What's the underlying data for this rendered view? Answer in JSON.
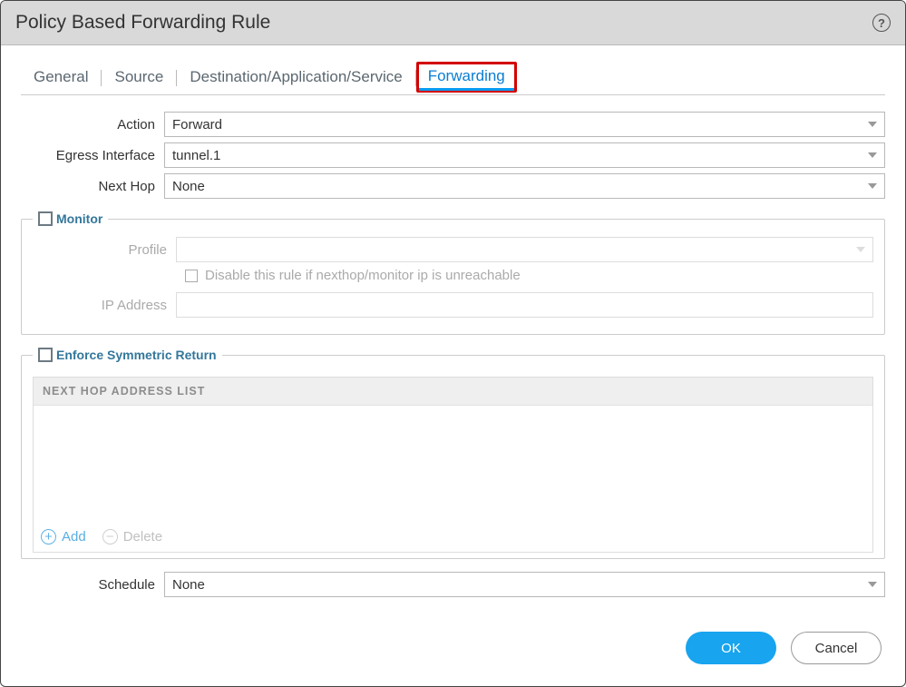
{
  "title": "Policy Based Forwarding Rule",
  "tabs": {
    "general": "General",
    "source": "Source",
    "dest": "Destination/Application/Service",
    "forwarding": "Forwarding"
  },
  "form": {
    "action_label": "Action",
    "action_value": "Forward",
    "egress_label": "Egress Interface",
    "egress_value": "tunnel.1",
    "nexthop_label": "Next Hop",
    "nexthop_value": "None"
  },
  "monitor": {
    "legend": "Monitor",
    "profile_label": "Profile",
    "profile_value": "",
    "disable_label": "Disable this rule if nexthop/monitor ip is unreachable",
    "ip_label": "IP Address",
    "ip_value": ""
  },
  "symmetric": {
    "legend": "Enforce Symmetric Return",
    "list_title": "NEXT HOP ADDRESS LIST",
    "add_label": "Add",
    "delete_label": "Delete"
  },
  "schedule": {
    "label": "Schedule",
    "value": "None"
  },
  "buttons": {
    "ok": "OK",
    "cancel": "Cancel"
  }
}
